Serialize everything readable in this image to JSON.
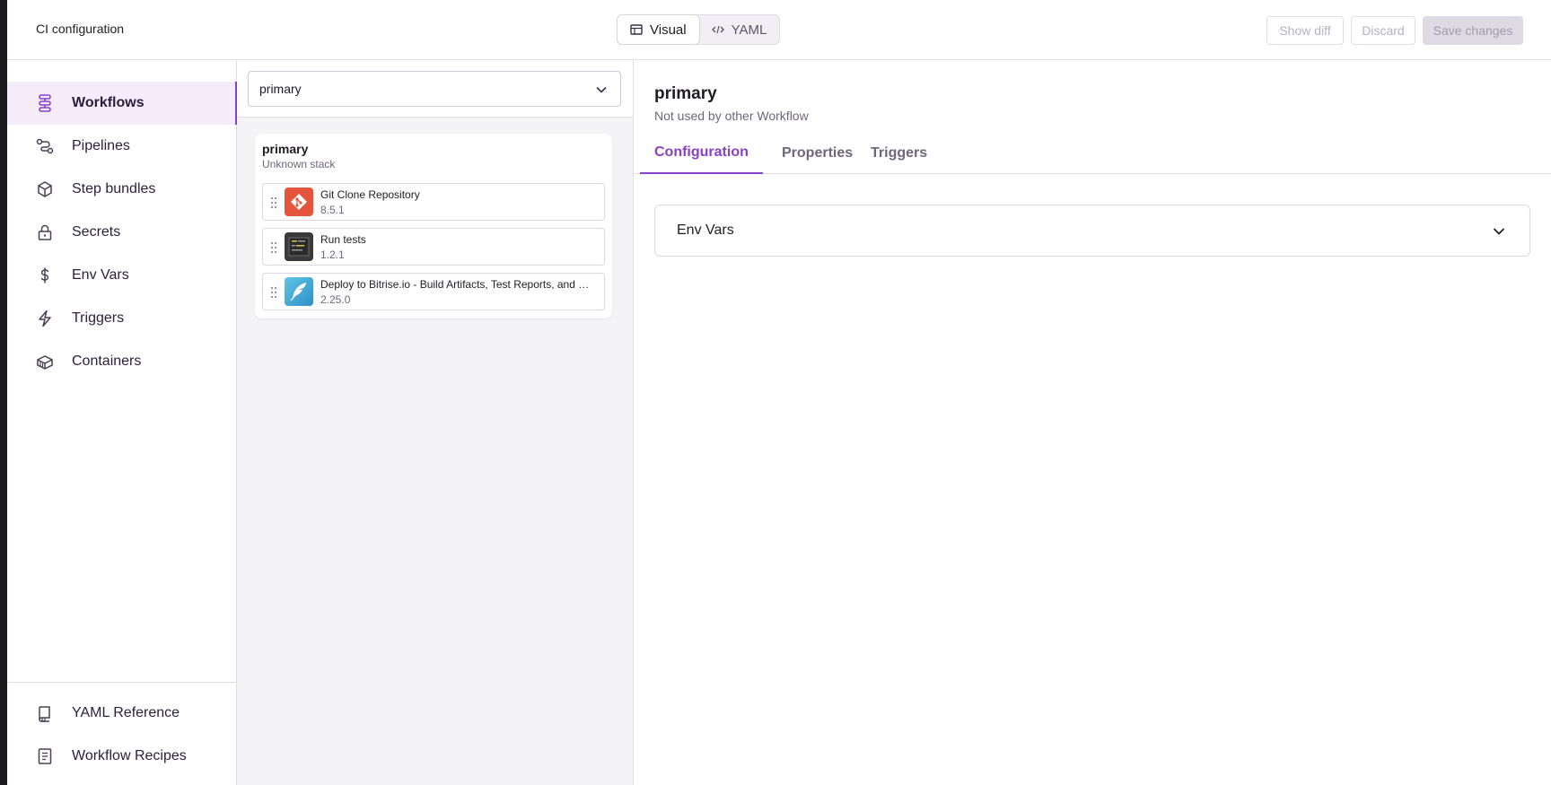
{
  "header": {
    "title": "CI configuration",
    "view_toggle": [
      {
        "label": "Visual",
        "icon": "table-icon",
        "active": true
      },
      {
        "label": "YAML",
        "icon": "code-icon",
        "active": false
      }
    ],
    "show_diff_label": "Show diff",
    "discard_label": "Discard",
    "save_label": "Save changes"
  },
  "sidebar": {
    "items": [
      {
        "label": "Workflows",
        "icon": "workflows-icon",
        "active": true
      },
      {
        "label": "Pipelines",
        "icon": "pipelines-icon"
      },
      {
        "label": "Step bundles",
        "icon": "cube-icon"
      },
      {
        "label": "Secrets",
        "icon": "lock-icon"
      },
      {
        "label": "Env Vars",
        "icon": "dollar-icon"
      },
      {
        "label": "Triggers",
        "icon": "lightning-icon"
      },
      {
        "label": "Containers",
        "icon": "container-icon"
      }
    ],
    "footer_items": [
      {
        "label": "YAML Reference",
        "icon": "book-icon"
      },
      {
        "label": "Workflow Recipes",
        "icon": "document-icon"
      }
    ]
  },
  "workflow_panel": {
    "selected_workflow": "primary",
    "card": {
      "title": "primary",
      "stack": "Unknown stack",
      "steps": [
        {
          "name": "Git Clone Repository",
          "version": "8.5.1",
          "icon": "git-icon",
          "color": "#e4553c"
        },
        {
          "name": "Run tests",
          "version": "1.2.1",
          "icon": "script-icon",
          "color": "#3a3a3a"
        },
        {
          "name": "Deploy to Bitrise.io - Build Artifacts, Test Reports, and …",
          "version": "2.25.0",
          "icon": "feather-icon",
          "color": "#3aa6d8"
        }
      ]
    }
  },
  "details": {
    "title": "primary",
    "subtitle": "Not used by other Workflow",
    "tabs": [
      {
        "label": "Configuration",
        "active": true
      },
      {
        "label": "Properties"
      },
      {
        "label": "Triggers"
      }
    ],
    "section_title": "Env Vars"
  },
  "colors": {
    "accent": "#8a3fc7",
    "active_bg": "#f4ecfb"
  }
}
